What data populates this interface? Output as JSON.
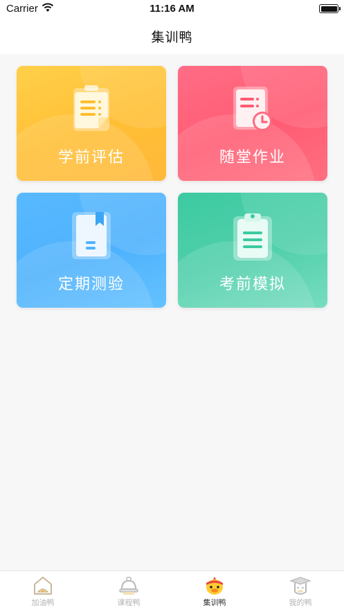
{
  "status_bar": {
    "carrier": "Carrier",
    "time": "11:16 AM"
  },
  "nav": {
    "title": "集训鸭"
  },
  "cards": [
    {
      "label": "学前评估",
      "icon": "clipboard-list-icon",
      "color": "#ffc43d"
    },
    {
      "label": "随堂作业",
      "icon": "document-clock-icon",
      "color": "#ff6178"
    },
    {
      "label": "定期测验",
      "icon": "bookmark-document-icon",
      "color": "#55b7ff"
    },
    {
      "label": "考前模拟",
      "icon": "clipboard-lines-icon",
      "color": "#4ccca8"
    }
  ],
  "tabs": [
    {
      "label": "加油鸭",
      "icon": "home-duck-icon",
      "active": false
    },
    {
      "label": "课程鸭",
      "icon": "bell-duck-icon",
      "active": false
    },
    {
      "label": "集训鸭",
      "icon": "duck-headband-icon",
      "active": true
    },
    {
      "label": "我的鸭",
      "icon": "graduate-duck-icon",
      "active": false
    }
  ]
}
